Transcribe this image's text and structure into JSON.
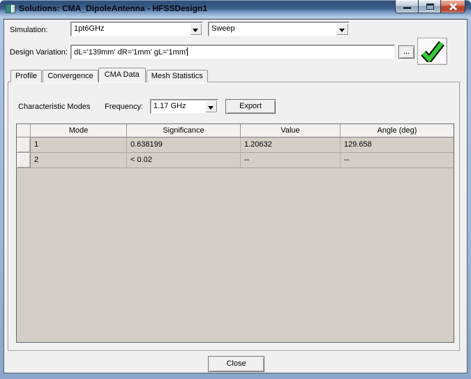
{
  "window": {
    "title": "Solutions: CMA_DipoleAntenna - HFSSDesign1"
  },
  "simulation": {
    "label": "Simulation:",
    "setup_value": "1pt6GHz",
    "sweep_value": "Sweep"
  },
  "design_variation": {
    "label": "Design Variation:",
    "value": "dL='139mm' dR='1mm' gL='1mm'",
    "browse_label": "..."
  },
  "tabs": [
    {
      "label": "Profile"
    },
    {
      "label": "Convergence"
    },
    {
      "label": "CMA Data"
    },
    {
      "label": "Mesh Statistics"
    }
  ],
  "cma": {
    "section_label": "Characteristic Modes",
    "frequency_label": "Frequency:",
    "frequency_value": "1.17 GHz",
    "export_label": "Export",
    "table": {
      "columns": [
        "Mode",
        "Significance",
        "Value",
        "Angle (deg)"
      ],
      "rows": [
        [
          "1",
          "0.638199",
          "1.20632",
          "129.658"
        ],
        [
          "2",
          "< 0.02",
          "--",
          "--"
        ]
      ]
    }
  },
  "footer": {
    "close_label": "Close"
  },
  "colors": {
    "titlebar_blue": "#3d5f8c",
    "frame_blue": "#9db7d6",
    "client_gray": "#f0f0f0",
    "table_empty_tan": "#d3cfc7",
    "check_green": "#33cc33",
    "close_button_red": "#c04a32"
  }
}
